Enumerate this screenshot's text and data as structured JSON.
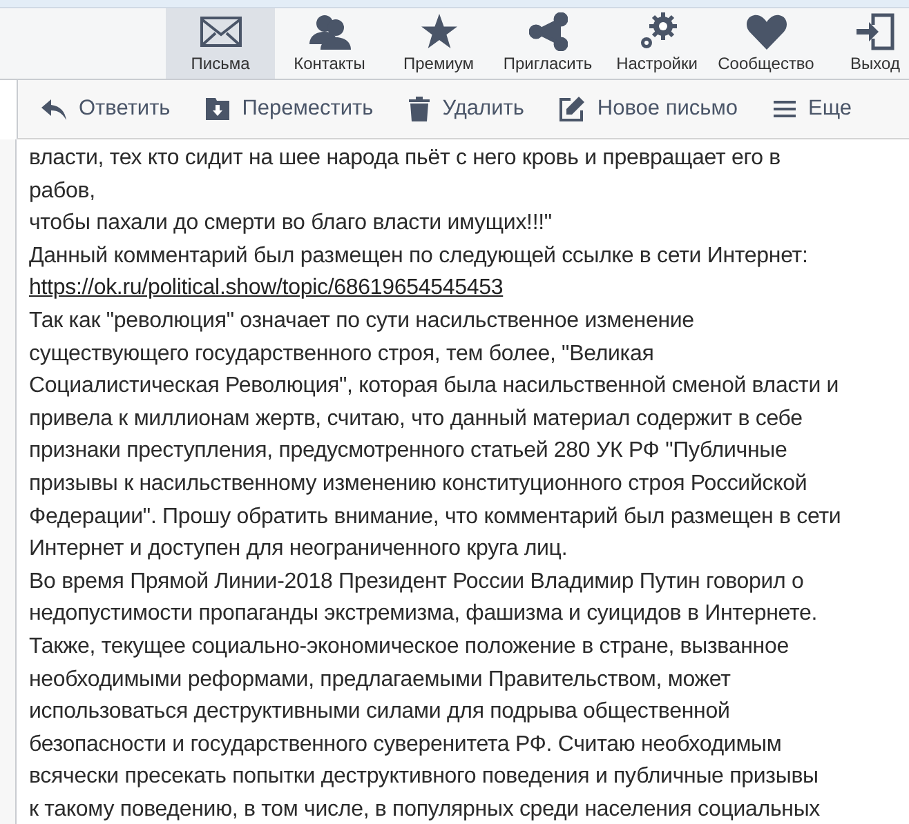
{
  "nav": [
    {
      "label": "Письма",
      "kind": "mail",
      "selected": true
    },
    {
      "label": "Контакты",
      "kind": "contacts",
      "selected": false
    },
    {
      "label": "Премиум",
      "kind": "premium",
      "selected": false
    },
    {
      "label": "Пригласить",
      "kind": "invite",
      "selected": false
    },
    {
      "label": "Настройки",
      "kind": "settings",
      "selected": false
    },
    {
      "label": "Сообщество",
      "kind": "community",
      "selected": false
    },
    {
      "label": "Выход",
      "kind": "logout",
      "selected": false
    }
  ],
  "toolbar": [
    {
      "label": "Ответить",
      "kind": "reply"
    },
    {
      "label": "Переместить",
      "kind": "move"
    },
    {
      "label": "Удалить",
      "kind": "delete"
    },
    {
      "label": "Новое письмо",
      "kind": "compose"
    },
    {
      "label": "Еще",
      "kind": "more"
    }
  ],
  "message_lines": [
    {
      "kind": "text",
      "text": "власти, тех кто сидит на шее народа пьёт с него кровь и превращает его в"
    },
    {
      "kind": "text",
      "text": "рабов,"
    },
    {
      "kind": "text",
      "text": "чтобы пахали до смерти во благо власти имущих!!!\""
    },
    {
      "kind": "text",
      "text": "Данный комментарий был размещен по следующей ссылке в сети Интернет:"
    },
    {
      "kind": "link",
      "text": "https://ok.ru/political.show/topic/68619654545453"
    },
    {
      "kind": "text",
      "text": "Так как \"революция\" означает по сути насильственное изменение"
    },
    {
      "kind": "text",
      "text": "существующего государственного строя, тем более, \"Великая"
    },
    {
      "kind": "text",
      "text": "Социалистическая Революция\", которая была насильственной сменой власти и"
    },
    {
      "kind": "text",
      "text": "привела к миллионам жертв, считаю, что данный материал содержит в себе"
    },
    {
      "kind": "text",
      "text": "признаки преступления, предусмотренного статьей 280 УК РФ \"Публичные"
    },
    {
      "kind": "text",
      "text": "призывы к насильственному изменению конституционного строя Российской"
    },
    {
      "kind": "text",
      "text": "Федерации\". Прошу обратить внимание, что комментарий был размещен в сети"
    },
    {
      "kind": "text",
      "text": "Интернет и доступен для неограниченного круга лиц."
    },
    {
      "kind": "text",
      "text": "Во время Прямой Линии-2018 Президент России Владимир Путин говорил о"
    },
    {
      "kind": "text",
      "text": "недопустимости пропаганды экстремизма, фашизма и суицидов в Интернете."
    },
    {
      "kind": "text",
      "text": "Также, текущее социально-экономическое положение в стране, вызванное"
    },
    {
      "kind": "text",
      "text": "необходимыми реформами, предлагаемыми Правительством, может"
    },
    {
      "kind": "text",
      "text": "использоваться деструктивными силами для подрыва общественной"
    },
    {
      "kind": "text",
      "text": "безопасности и государственного суверенитета РФ. Считаю необходимым"
    },
    {
      "kind": "text",
      "text": "всячески пресекать попытки деструктивного поведения и публичные призывы"
    },
    {
      "kind": "text",
      "text": "к такому поведению, в том числе, в популярных среди населения социальных"
    }
  ]
}
